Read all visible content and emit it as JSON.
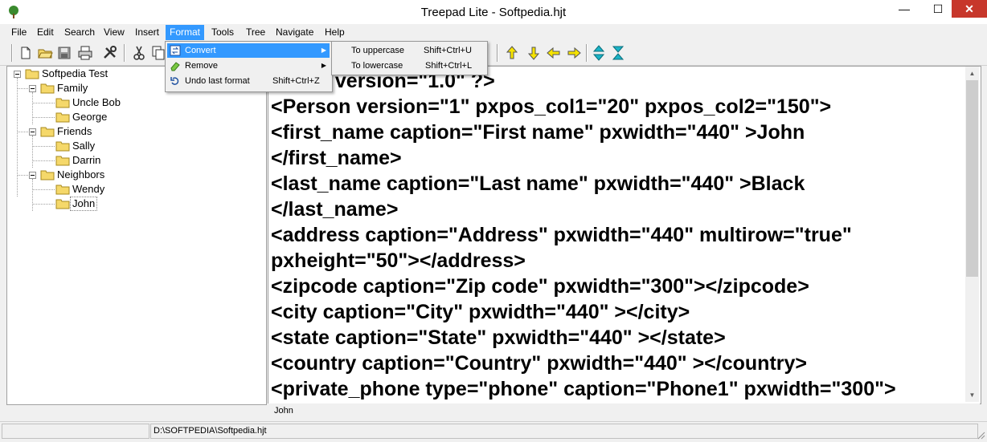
{
  "window": {
    "title": "Treepad Lite - Softpedia.hjt",
    "minimize": "—",
    "maximize": "☐",
    "close": "✕"
  },
  "menu": [
    {
      "label": "File",
      "name": "menu-file"
    },
    {
      "label": "Edit",
      "name": "menu-edit"
    },
    {
      "label": "Search",
      "name": "menu-search"
    },
    {
      "label": "View",
      "name": "menu-view"
    },
    {
      "label": "Insert",
      "name": "menu-insert"
    },
    {
      "label": "Format",
      "name": "menu-format"
    },
    {
      "label": "Tools",
      "name": "menu-tools"
    },
    {
      "label": "Tree",
      "name": "menu-tree"
    },
    {
      "label": "Navigate",
      "name": "menu-navigate"
    },
    {
      "label": "Help",
      "name": "menu-help"
    }
  ],
  "format_menu": {
    "items": [
      {
        "label": "Convert",
        "shortcut": "",
        "icon": "convert-icon",
        "submenu": true
      },
      {
        "label": "Remove",
        "shortcut": "",
        "icon": "eraser-icon",
        "submenu": true
      },
      {
        "label": "Undo last format",
        "shortcut": "Shift+Ctrl+Z",
        "icon": "undo-icon",
        "submenu": false
      }
    ]
  },
  "convert_submenu": {
    "items": [
      {
        "label": "To uppercase",
        "shortcut": "Shift+Ctrl+U"
      },
      {
        "label": "To lowercase",
        "shortcut": "Shift+Ctrl+L"
      }
    ]
  },
  "tree": {
    "nodes": [
      {
        "label": "Softpedia Test",
        "level": 0,
        "expandable": true
      },
      {
        "label": "Family",
        "level": 1,
        "expandable": true
      },
      {
        "label": "Uncle Bob",
        "level": 2,
        "expandable": false
      },
      {
        "label": "George",
        "level": 2,
        "expandable": false
      },
      {
        "label": "Friends",
        "level": 1,
        "expandable": true
      },
      {
        "label": "Sally",
        "level": 2,
        "expandable": false
      },
      {
        "label": "Darrin",
        "level": 2,
        "expandable": false
      },
      {
        "label": "Neighbors",
        "level": 1,
        "expandable": true
      },
      {
        "label": "Wendy",
        "level": 2,
        "expandable": false
      },
      {
        "label": "John",
        "level": 2,
        "expandable": false,
        "selected": true
      }
    ]
  },
  "editor": {
    "lines": [
      "<?xml version=\"1.0\" ?>",
      "<Person version=\"1\" pxpos_col1=\"20\" pxpos_col2=\"150\">",
      "<first_name caption=\"First name\"  pxwidth=\"440\" >John",
      "</first_name>",
      "<last_name caption=\"Last name\"  pxwidth=\"440\" >Black",
      "</last_name>",
      "<address caption=\"Address\" pxwidth=\"440\" multirow=\"true\"",
      "pxheight=\"50\"></address>",
      "<zipcode caption=\"Zip code\" pxwidth=\"300\"></zipcode>",
      "<city caption=\"City\"  pxwidth=\"440\" ></city>",
      "<state caption=\"State\"  pxwidth=\"440\" ></state>",
      "<country caption=\"Country\"  pxwidth=\"440\" ></country>",
      "<private_phone type=\"phone\" caption=\"Phone1\" pxwidth=\"300\">"
    ]
  },
  "node_label": "John",
  "status": {
    "path": "D:\\SOFTPEDIA\\Softpedia.hjt"
  },
  "colors": {
    "accent": "#3399ff",
    "folder": "#f5d86a",
    "arrow_yellow": "#f7e400",
    "arrow_teal": "#1ab3c6"
  }
}
